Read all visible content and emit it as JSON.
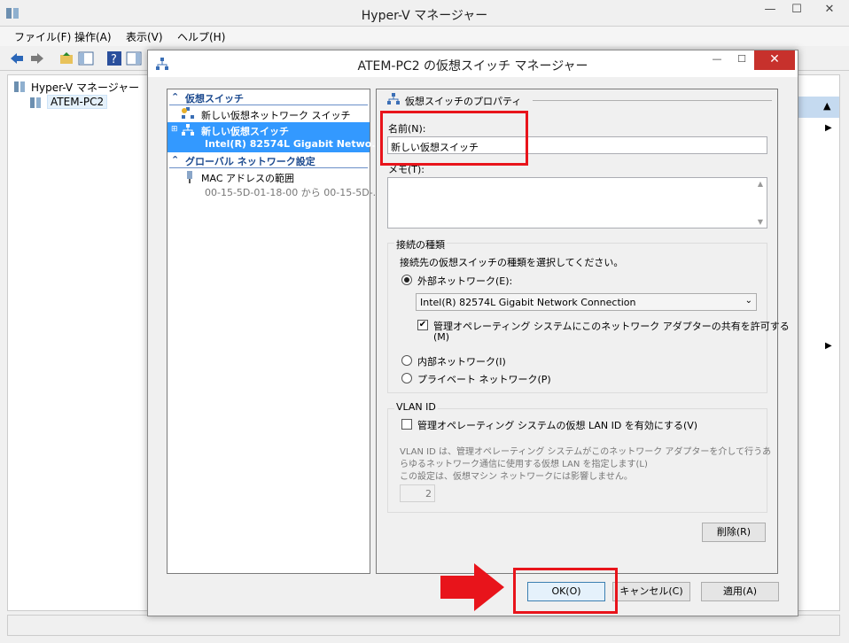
{
  "outer_window": {
    "title": "Hyper-V マネージャー",
    "menu": [
      "ファイル(F)",
      "操作(A)",
      "表示(V)",
      "ヘルプ(H)"
    ],
    "tree": {
      "root": "Hyper-V マネージャー",
      "server": "ATEM-PC2"
    }
  },
  "dialog": {
    "title": "ATEM-PC2 の仮想スイッチ マネージャー",
    "list": {
      "category_switch": "仮想スイッチ",
      "new_network_switch": "新しい仮想ネットワーク スイッチ",
      "selected_switch_name": "新しい仮想スイッチ",
      "selected_switch_adapter": "Intel(R) 82574L Gigabit Netwo...",
      "category_global": "グローバル ネットワーク設定",
      "mac_range_label": "MAC アドレスの範囲",
      "mac_range_value": "00-15-5D-01-18-00 から 00-15-5D-..."
    },
    "props": {
      "section_title": "仮想スイッチのプロパティ",
      "name_label": "名前(N):",
      "name_value": "新しい仮想スイッチ",
      "memo_label": "メモ(T):",
      "conn_group_title": "接続の種類",
      "conn_prompt": "接続先の仮想スイッチの種類を選択してください。",
      "radio_external": "外部ネットワーク(E):",
      "adapter_selected": "Intel(R) 82574L Gigabit Network Connection",
      "share_line1": "管理オペレーティング システムにこのネットワーク アダプターの共有を許可する",
      "share_line2": "(M)",
      "radio_internal": "内部ネットワーク(I)",
      "radio_private": "プライベート ネットワーク(P)",
      "vlan_group_title": "VLAN ID",
      "vlan_checkbox": "管理オペレーティング システムの仮想 LAN ID を有効にする(V)",
      "vlan_desc1": "VLAN ID は、管理オペレーティング システムがこのネットワーク アダプターを介して行うあ",
      "vlan_desc2": "らゆるネットワーク通信に使用する仮想 LAN を指定します(L)",
      "vlan_desc3": "この設定は、仮想マシン ネットワークには影響しません。",
      "vlan_value": "2",
      "delete_button": "削除(R)"
    },
    "buttons": {
      "ok": "OK(O)",
      "cancel": "キャンセル(C)",
      "apply": "適用(A)"
    }
  },
  "colors": {
    "selection": "#3399ff",
    "highlight": "#e8141b",
    "close": "#c7312c"
  }
}
